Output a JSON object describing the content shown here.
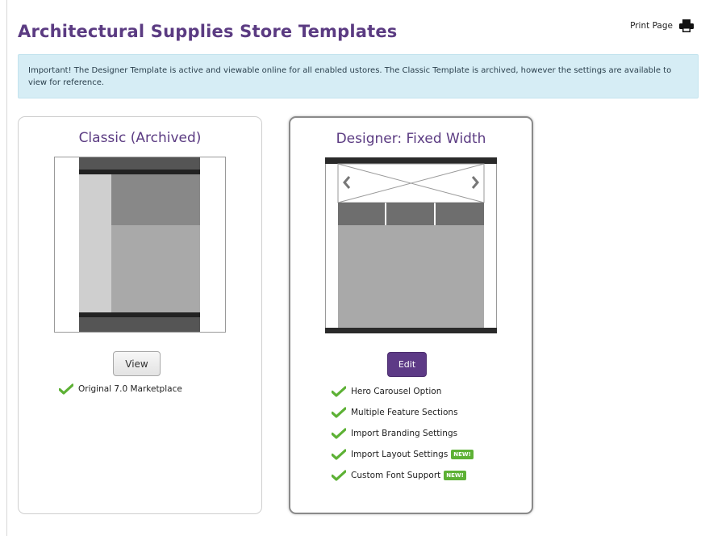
{
  "page": {
    "title": "Architectural Supplies Store Templates",
    "print_label": "Print Page"
  },
  "notice": {
    "text": "Important! The Designer Template is active and viewable online for all enabled ustores. The Classic Template is archived, however the settings are available to view for reference."
  },
  "cards": {
    "classic": {
      "title": "Classic (Archived)",
      "button_label": "View",
      "features": [
        {
          "label": "Original 7.0 Marketplace",
          "new": false
        }
      ]
    },
    "designer": {
      "title": "Designer: Fixed Width",
      "button_label": "Edit",
      "features": [
        {
          "label": "Hero Carousel Option",
          "new": false
        },
        {
          "label": "Multiple Feature Sections",
          "new": false
        },
        {
          "label": "Import Branding Settings",
          "new": false
        },
        {
          "label": "Import Layout Settings",
          "new": true
        },
        {
          "label": "Custom Font Support",
          "new": true
        }
      ]
    }
  },
  "badge_label": "NEW!",
  "colors": {
    "accent_purple": "#5b3b82",
    "notice_bg": "#d6edf5",
    "check_green": "#5db135"
  },
  "icons": {
    "print": "printer-icon",
    "check": "checkmark-icon",
    "carousel_prev": "chevron-left-icon",
    "carousel_next": "chevron-right-icon"
  }
}
